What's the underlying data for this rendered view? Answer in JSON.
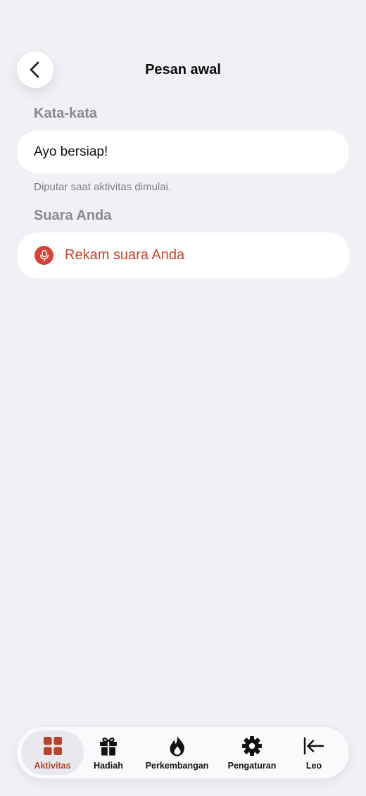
{
  "header": {
    "title": "Pesan awal",
    "back_icon": "chevron-left-icon"
  },
  "words_section": {
    "label": "Kata-kata",
    "input_value": "Ayo bersiap!",
    "helper": "Diputar saat aktivitas dimulai."
  },
  "voice_section": {
    "label": "Suara Anda",
    "record_label": "Rekam suara Anda",
    "record_icon": "microphone-icon"
  },
  "tab_bar": {
    "items": [
      {
        "label": "Aktivitas",
        "icon": "grid-icon",
        "active": true
      },
      {
        "label": "Hadiah",
        "icon": "gift-icon",
        "active": false
      },
      {
        "label": "Perkembangan",
        "icon": "flame-icon",
        "active": false
      },
      {
        "label": "Pengaturan",
        "icon": "gear-icon",
        "active": false
      },
      {
        "label": "Leo",
        "icon": "arrow-left-to-line-icon",
        "active": false
      }
    ]
  },
  "colors": {
    "background": "#f1f0f5",
    "accent": "#b5432d",
    "record_red": "#d84236",
    "muted_text": "#8a8a8e"
  }
}
